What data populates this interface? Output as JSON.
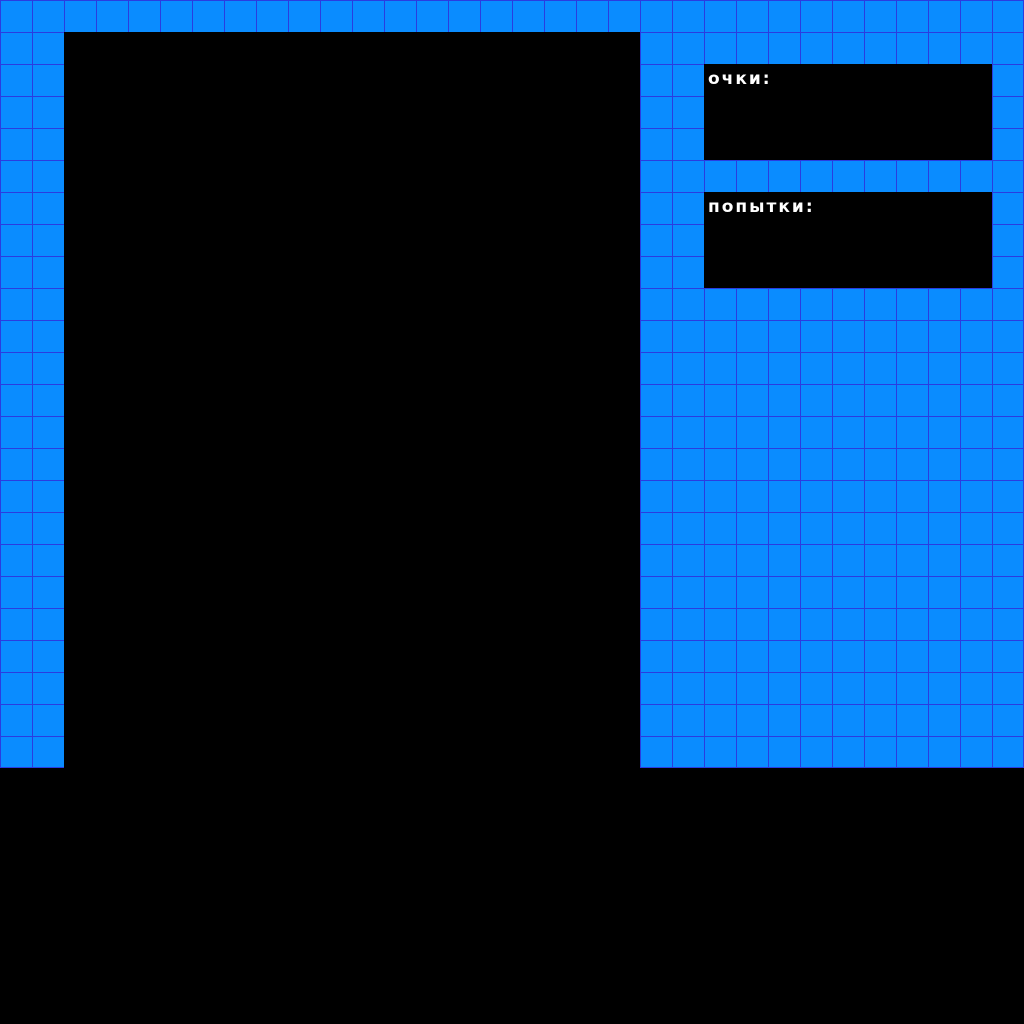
{
  "game": {
    "colors": {
      "frame_fill": "#0a8cff",
      "grid_line": "#2a3ce0",
      "background": "#000000",
      "text": "#ffffff"
    },
    "score": {
      "label": "очки:",
      "value": ""
    },
    "attempts": {
      "label": "попытки:",
      "value": ""
    }
  }
}
